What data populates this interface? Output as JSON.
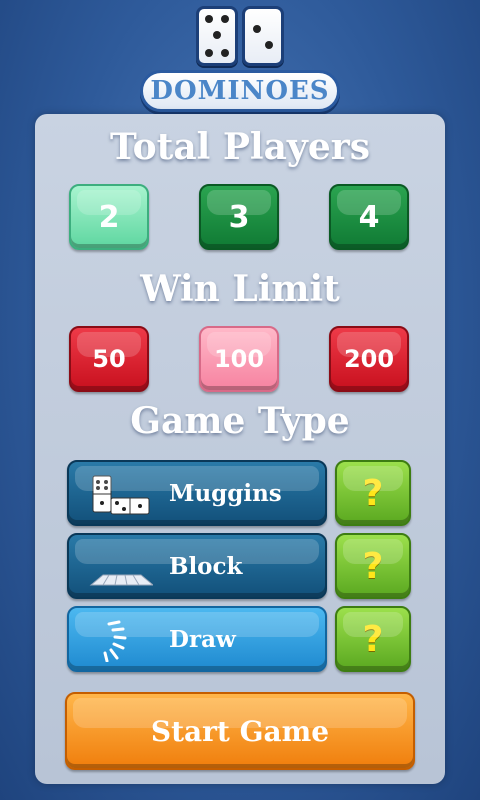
{
  "logo": {
    "title": "DOMINOES"
  },
  "players": {
    "heading": "Total Players",
    "options": [
      {
        "label": "2",
        "selected": true
      },
      {
        "label": "3",
        "selected": false
      },
      {
        "label": "4",
        "selected": false
      }
    ]
  },
  "win_limit": {
    "heading": "Win Limit",
    "options": [
      {
        "label": "50",
        "selected": false
      },
      {
        "label": "100",
        "selected": true
      },
      {
        "label": "200",
        "selected": false
      }
    ]
  },
  "game_type": {
    "heading": "Game Type",
    "options": [
      {
        "label": "Muggins",
        "icon": "dominoes-icon",
        "selected": false,
        "help": "?"
      },
      {
        "label": "Block",
        "icon": "domino-row-icon",
        "selected": false,
        "help": "?"
      },
      {
        "label": "Draw",
        "icon": "spinner-icon",
        "selected": true,
        "help": "?"
      }
    ]
  },
  "start_button": {
    "label": "Start Game"
  },
  "colors": {
    "background": "#2e5a9a",
    "panel": "#c1ccdc",
    "player_green": "#1f8f42",
    "player_selected": "#7fe4b4",
    "limit_red": "#dc2030",
    "limit_selected": "#f99ab2",
    "type_dark_blue": "#1d6690",
    "type_selected_blue": "#36a0e0",
    "help_green": "#7cc436",
    "help_mark": "#ffe61a",
    "start_orange": "#f79a2a"
  }
}
